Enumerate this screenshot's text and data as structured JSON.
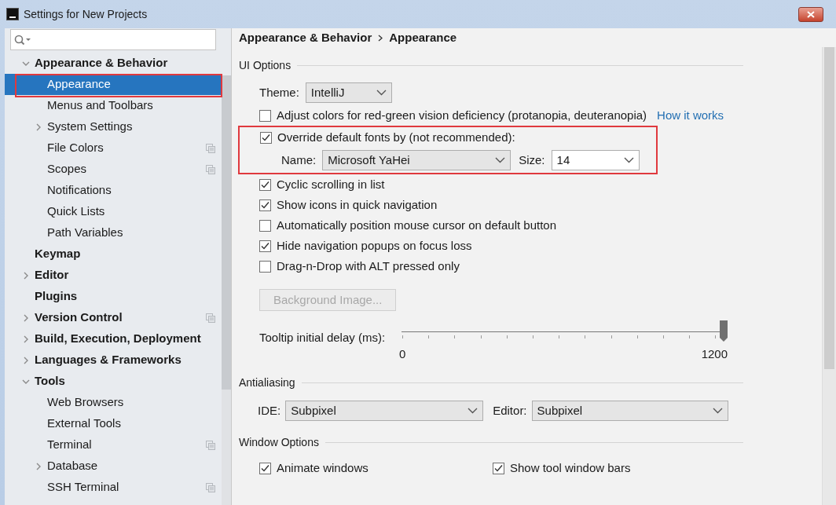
{
  "window": {
    "title": "Settings for New Projects"
  },
  "sidebar": {
    "items": [
      {
        "label": "Appearance & Behavior",
        "expanded": true,
        "selected": false,
        "children": [
          {
            "label": "Appearance",
            "selected": true,
            "highlighted": true
          },
          {
            "label": "Menus and Toolbars",
            "selected": false
          },
          {
            "label": "System Settings",
            "expanded": false,
            "selected": false
          },
          {
            "label": "File Colors",
            "selected": false,
            "copy_icon": true
          },
          {
            "label": "Scopes",
            "selected": false,
            "copy_icon": true
          },
          {
            "label": "Notifications",
            "selected": false
          },
          {
            "label": "Quick Lists",
            "selected": false
          },
          {
            "label": "Path Variables",
            "selected": false
          }
        ]
      },
      {
        "label": "Keymap",
        "selected": false
      },
      {
        "label": "Editor",
        "expanded": false,
        "selected": false
      },
      {
        "label": "Plugins",
        "selected": false
      },
      {
        "label": "Version Control",
        "expanded": false,
        "selected": false,
        "copy_icon": true
      },
      {
        "label": "Build, Execution, Deployment",
        "expanded": false,
        "selected": false
      },
      {
        "label": "Languages & Frameworks",
        "expanded": false,
        "selected": false
      },
      {
        "label": "Tools",
        "expanded": true,
        "selected": false,
        "children": [
          {
            "label": "Web Browsers",
            "selected": false
          },
          {
            "label": "External Tools",
            "selected": false
          },
          {
            "label": "Terminal",
            "selected": false,
            "copy_icon": true
          },
          {
            "label": "Database",
            "expanded": false,
            "selected": false
          },
          {
            "label": "SSH Terminal",
            "selected": false,
            "copy_icon": true
          }
        ]
      }
    ]
  },
  "breadcrumb": [
    "Appearance & Behavior",
    "Appearance"
  ],
  "sections": [
    {
      "title": "UI Options",
      "rows": [
        {
          "kind": "select",
          "label": "Theme:",
          "value": "IntelliJ"
        },
        {
          "kind": "checkbox",
          "label": "Adjust colors for red-green vision deficiency (protanopia, deuteranopia)",
          "checked": false,
          "link": "How it works"
        },
        {
          "kind": "fonts",
          "label": "Override default fonts by (not recommended):",
          "checked": true,
          "highlighted": true,
          "fields": [
            {
              "label": "Name:",
              "value": "Microsoft YaHei"
            },
            {
              "label": "Size:",
              "value": "14"
            }
          ]
        },
        {
          "kind": "checkbox",
          "label": "Cyclic scrolling in list",
          "checked": true
        },
        {
          "kind": "checkbox",
          "label": "Show icons in quick navigation",
          "checked": true
        },
        {
          "kind": "checkbox",
          "label": "Automatically position mouse cursor on default button",
          "checked": false
        },
        {
          "kind": "checkbox",
          "label": "Hide navigation popups on focus loss",
          "checked": true
        },
        {
          "kind": "checkbox",
          "label": "Drag-n-Drop with ALT pressed only",
          "checked": false
        },
        {
          "kind": "button",
          "label": "Background Image...",
          "disabled": true
        },
        {
          "kind": "slider",
          "label": "Tooltip initial delay (ms):",
          "level": 1,
          "min_label": "0",
          "max_label": "1200"
        }
      ]
    },
    {
      "title": "Antialiasing",
      "rows": [
        {
          "kind": "select_pair",
          "fields": [
            {
              "label": "IDE:",
              "value": "Subpixel"
            },
            {
              "label": "Editor:",
              "value": "Subpixel"
            }
          ]
        }
      ]
    },
    {
      "title": "Window Options",
      "rows": [
        {
          "kind": "checkbox_pair",
          "items": [
            {
              "label": "Animate windows",
              "checked": true
            },
            {
              "label": "Show tool window bars",
              "checked": true
            }
          ]
        }
      ]
    }
  ]
}
